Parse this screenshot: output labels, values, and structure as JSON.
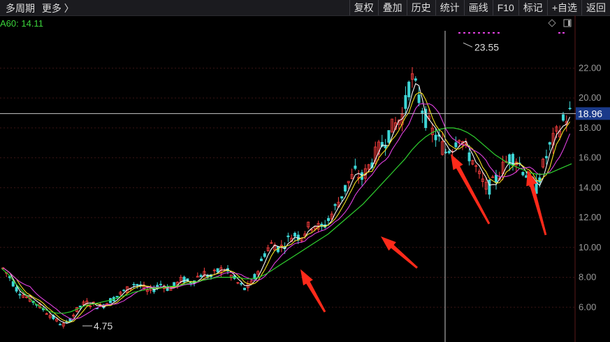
{
  "toolbar": {
    "period_label": "多周期",
    "more_label": "更多 〉",
    "buttons": [
      "复权",
      "叠加",
      "历史",
      "统计",
      "画线",
      "F10",
      "标记",
      "+自选",
      "返回"
    ]
  },
  "ma_label": "A60: 14.11",
  "icons": {
    "diamond": "diamond-icon",
    "layout": "panel-layout-icon"
  },
  "colors": {
    "background": "#000000",
    "grid": "#3a1414",
    "up_candle": "#ff4040",
    "down_candle": "#3ed6d6",
    "ma_short": "#f5f5f5",
    "ma_mid": "#f0e020",
    "ma_long": "#e040e0",
    "ma60": "#2fd12f",
    "crosshair": "#c8c8c8",
    "price_tag": "#1a3a8a",
    "arrow": "#ff2a1a"
  },
  "chart_data": {
    "type": "candlestick",
    "ylim": [
      4.0,
      24.5
    ],
    "yticks": [
      6.0,
      8.0,
      10.0,
      12.0,
      14.0,
      16.0,
      18.0,
      20.0,
      22.0
    ],
    "ytick_labels": [
      "6.00",
      "8.00",
      "10.00",
      "12.00",
      "14.00",
      "16.00",
      "18.00",
      "20.00",
      "22.00"
    ],
    "grid": true,
    "crosshair_price": 18.96,
    "crosshair_label": "18.96",
    "max_label": "23.55",
    "min_label": "4.75",
    "approx_close_path": [
      8.6,
      8.0,
      7.2,
      6.8,
      6.5,
      6.2,
      5.8,
      5.4,
      5.0,
      4.75,
      5.4,
      6.0,
      6.3,
      6.2,
      6.0,
      6.3,
      6.6,
      6.9,
      7.2,
      7.6,
      7.4,
      7.0,
      7.3,
      7.6,
      7.2,
      7.5,
      7.9,
      7.6,
      8.0,
      8.3,
      8.0,
      8.4,
      8.6,
      8.1,
      7.6,
      7.2,
      7.6,
      8.6,
      9.8,
      10.3,
      9.9,
      10.4,
      10.9,
      10.7,
      11.3,
      11.6,
      11.2,
      11.8,
      12.6,
      13.5,
      14.4,
      15.0,
      14.6,
      15.5,
      16.3,
      17.0,
      17.8,
      18.4,
      19.0,
      21.5,
      20.2,
      18.8,
      17.8,
      17.2,
      16.4,
      16.8,
      17.6,
      16.5,
      15.8,
      14.6,
      13.9,
      14.3,
      15.1,
      15.9,
      16.1,
      15.4,
      14.7,
      13.8,
      15.3,
      16.6,
      17.5,
      18.4,
      18.96
    ],
    "series": [
      {
        "name": "A60",
        "values": [
          8.6,
          8.2,
          7.6,
          7.1,
          6.6,
          6.2,
          5.9,
          5.7,
          5.6,
          5.6,
          5.7,
          5.9,
          6.1,
          6.2,
          6.3,
          6.4,
          6.5,
          6.7,
          6.8,
          7.0,
          7.1,
          7.2,
          7.3,
          7.3,
          7.4,
          7.4,
          7.5,
          7.6,
          7.7,
          7.8,
          7.9,
          8.0,
          8.0,
          8.0,
          8.0,
          7.9,
          7.9,
          8.0,
          8.2,
          8.5,
          8.8,
          9.1,
          9.4,
          9.7,
          10.0,
          10.3,
          10.6,
          10.9,
          11.3,
          11.7,
          12.1,
          12.5,
          12.9,
          13.4,
          13.9,
          14.4,
          14.9,
          15.4,
          15.9,
          16.5,
          17.0,
          17.4,
          17.7,
          17.9,
          18.0,
          18.0,
          17.9,
          17.7,
          17.4,
          17.0,
          16.6,
          16.2,
          15.9,
          15.6,
          15.4,
          15.2,
          15.0,
          14.9,
          14.9,
          15.0,
          15.2,
          15.4,
          15.6
        ]
      }
    ]
  }
}
